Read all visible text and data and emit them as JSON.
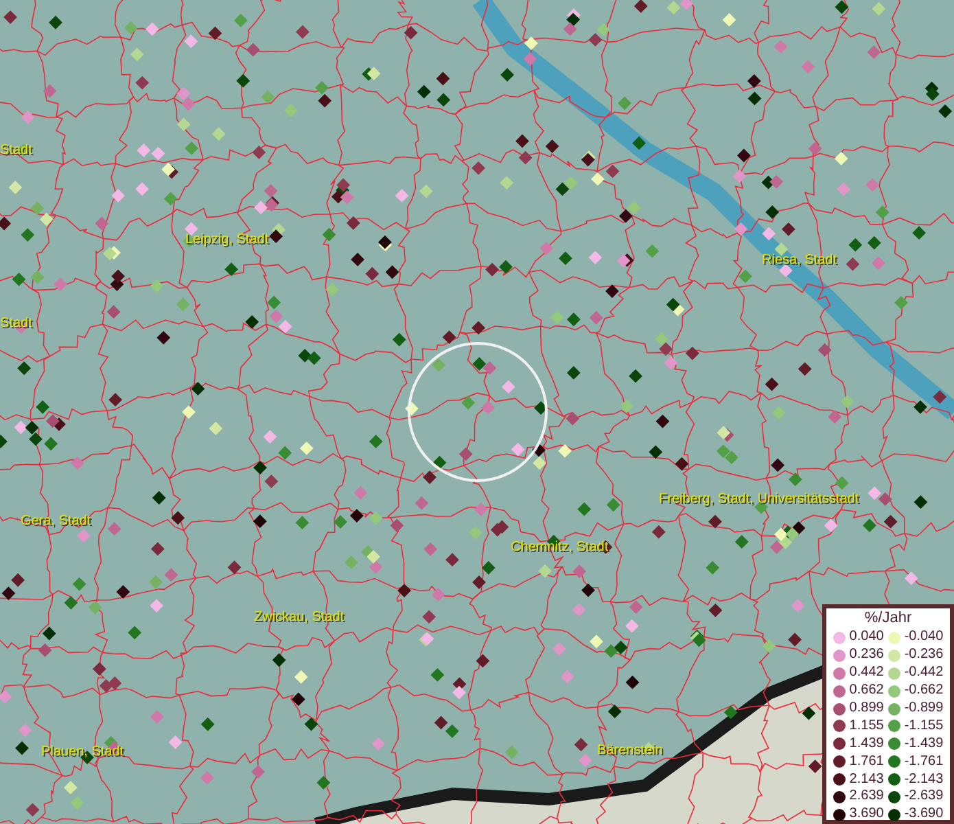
{
  "map": {
    "labels": [
      {
        "text": "Stadt"
      },
      {
        "text": "Leipzig, Stadt"
      },
      {
        "text": "Stadt"
      },
      {
        "text": "Riesa, Stadt"
      },
      {
        "text": "Gera, Stadt"
      },
      {
        "text": "Freiberg, Stadt, Universitätsstadt"
      },
      {
        "text": "Chemnitz, Stadt"
      },
      {
        "text": "Zwickau, Stadt"
      },
      {
        "text": "Plauen, Stadt"
      },
      {
        "text": "Bärenstein"
      }
    ]
  },
  "legend": {
    "title": "%/Jahr",
    "columns": [
      {
        "items": [
          {
            "label": "0.040",
            "color": "#f4b8e6"
          },
          {
            "label": "0.236",
            "color": "#e096c8"
          },
          {
            "label": "0.442",
            "color": "#d078a8"
          },
          {
            "label": "0.662",
            "color": "#c06690"
          },
          {
            "label": "0.899",
            "color": "#a84e70"
          },
          {
            "label": "1.155",
            "color": "#903a52"
          },
          {
            "label": "1.439",
            "color": "#7a2a3c"
          },
          {
            "label": "1.761",
            "color": "#621c28"
          },
          {
            "label": "2.143",
            "color": "#4a1018"
          },
          {
            "label": "2.639",
            "color": "#320810"
          },
          {
            "label": "3.690",
            "color": "#200408"
          }
        ]
      },
      {
        "items": [
          {
            "label": "-0.040",
            "color": "#eef8b4"
          },
          {
            "label": "-0.236",
            "color": "#d2e8a2"
          },
          {
            "label": "-0.442",
            "color": "#b4d890"
          },
          {
            "label": "-0.662",
            "color": "#94c87a"
          },
          {
            "label": "-0.899",
            "color": "#74b262"
          },
          {
            "label": "-1.155",
            "color": "#54a046"
          },
          {
            "label": "-1.439",
            "color": "#3a8c32"
          },
          {
            "label": "-1.761",
            "color": "#227620"
          },
          {
            "label": "-2.143",
            "color": "#125e12"
          },
          {
            "label": "-2.639",
            "color": "#0a460a"
          },
          {
            "label": "-3.690",
            "color": "#042e04"
          }
        ]
      }
    ]
  }
}
